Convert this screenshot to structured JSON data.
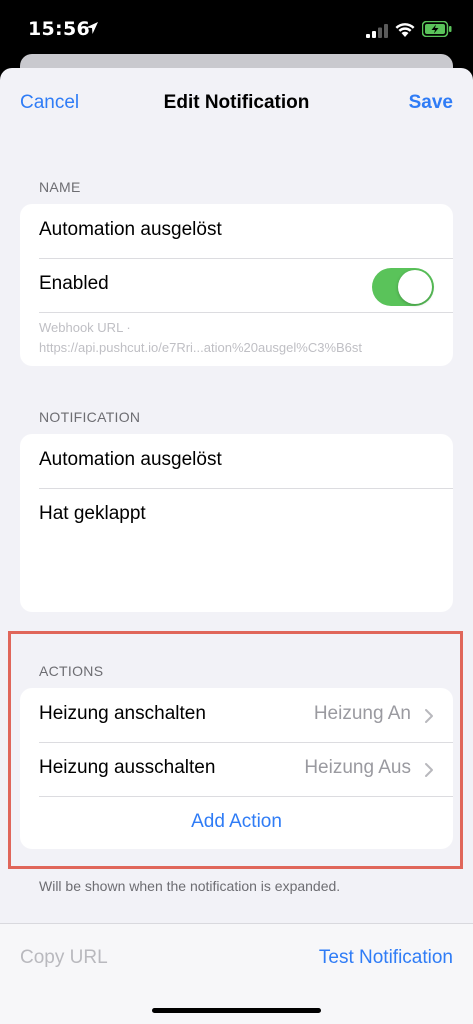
{
  "status_bar": {
    "time": "15:56"
  },
  "nav": {
    "cancel_label": "Cancel",
    "title": "Edit Notification",
    "save_label": "Save"
  },
  "name_section": {
    "header": "NAME",
    "name_value": "Automation ausgelöst",
    "enabled_label": "Enabled",
    "enabled": true,
    "webhook_label": "Webhook URL  ·",
    "webhook_url": "https://api.pushcut.io/e7Rri...ation%20ausgel%C3%B6st"
  },
  "notification_section": {
    "header": "NOTIFICATION",
    "title_value": "Automation ausgelöst",
    "body_value": "Hat geklappt"
  },
  "actions_section": {
    "header": "ACTIONS",
    "items": [
      {
        "label": "Heizung anschalten",
        "value": "Heizung An"
      },
      {
        "label": "Heizung ausschalten",
        "value": "Heizung Aus"
      }
    ],
    "add_label": "Add Action",
    "footer_note": "Will be shown when the notification is expanded."
  },
  "bottom_bar": {
    "copy_url_label": "Copy URL",
    "test_label": "Test Notification"
  },
  "colors": {
    "accent": "#2f7cf6",
    "toggle_on": "#5ac35a",
    "highlight_border": "#e0665a"
  }
}
